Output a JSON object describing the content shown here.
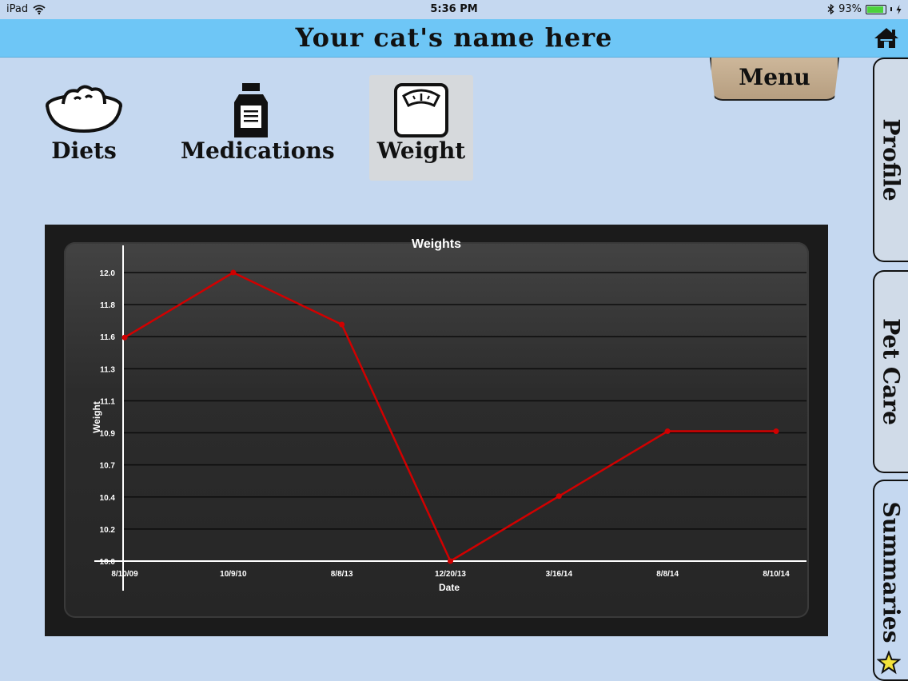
{
  "status_bar": {
    "device": "iPad",
    "time": "5:36 PM",
    "battery": "93%",
    "battery_level": 0.93
  },
  "header": {
    "title": "Your cat's name here",
    "home_icon": "home-icon"
  },
  "menu": {
    "label": "Menu"
  },
  "categories": [
    {
      "label": "Diets",
      "icon": "food-bowl-icon",
      "selected": false
    },
    {
      "label": "Medications",
      "icon": "medicine-bottle-icon",
      "selected": false
    },
    {
      "label": "Weight",
      "icon": "scale-icon",
      "selected": true
    }
  ],
  "side_tabs": [
    {
      "label": "Profile"
    },
    {
      "label": "Pet Care"
    },
    {
      "label": "Summaries",
      "active": true,
      "icon": "star-icon"
    }
  ],
  "colors": {
    "title_bar": "#6ec6f6",
    "background": "#c5d8f0",
    "series_line": "#d10000"
  },
  "chart_data": {
    "type": "line",
    "title": "Weights",
    "xlabel": "Date",
    "ylabel": "Weight",
    "categories": [
      "8/10/09",
      "10/9/10",
      "8/8/13",
      "12/20/13",
      "3/16/14",
      "8/8/14",
      "8/10/14"
    ],
    "series": [
      {
        "values": [
          11.55,
          12.0,
          11.64,
          10.0,
          10.45,
          10.9,
          10.9
        ]
      }
    ],
    "yticks": [
      "10.0",
      "10.2",
      "10.4",
      "10.7",
      "10.9",
      "11.1",
      "11.3",
      "11.6",
      "11.8",
      "12.0"
    ],
    "ylim": [
      10.0,
      12.0
    ],
    "grid": true
  }
}
